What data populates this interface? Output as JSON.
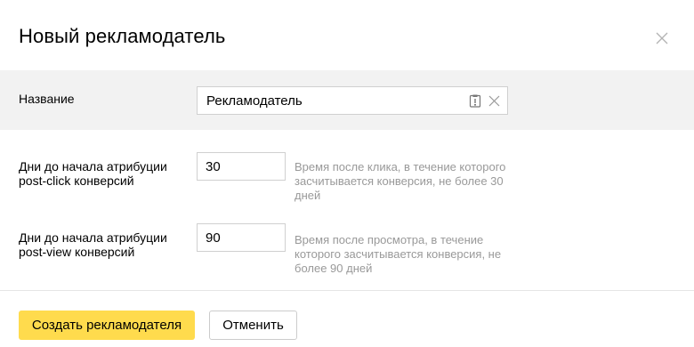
{
  "dialog": {
    "title": "Новый рекламодатель",
    "close_icon": "close-icon"
  },
  "form": {
    "name": {
      "label": "Название",
      "value": "Рекламодатель",
      "icons": [
        "clipboard-icon",
        "clear-icon"
      ]
    },
    "post_click": {
      "label_line1": "Дни до начала атрибуции",
      "label_line2": "post-click конверсий",
      "value": "30",
      "hint_line1": "Время после клика, в течение которого",
      "hint_line2": "засчитывается конверсия, не более 30",
      "hint_line3": "дней"
    },
    "post_view": {
      "label_line1": "Дни до начала атрибуции",
      "label_line2": "post-view конверсий",
      "value": "90",
      "hint_line1": "Время после просмотра, в течение",
      "hint_line2": "которого засчитывается конверсия, не",
      "hint_line3": "более 90 дней"
    }
  },
  "actions": {
    "create_label": "Создать рекламодателя",
    "cancel_label": "Отменить"
  },
  "colors": {
    "primary_button": "#ffdb4d",
    "name_row_background": "#f2f2f2",
    "hint_text": "#999999"
  }
}
